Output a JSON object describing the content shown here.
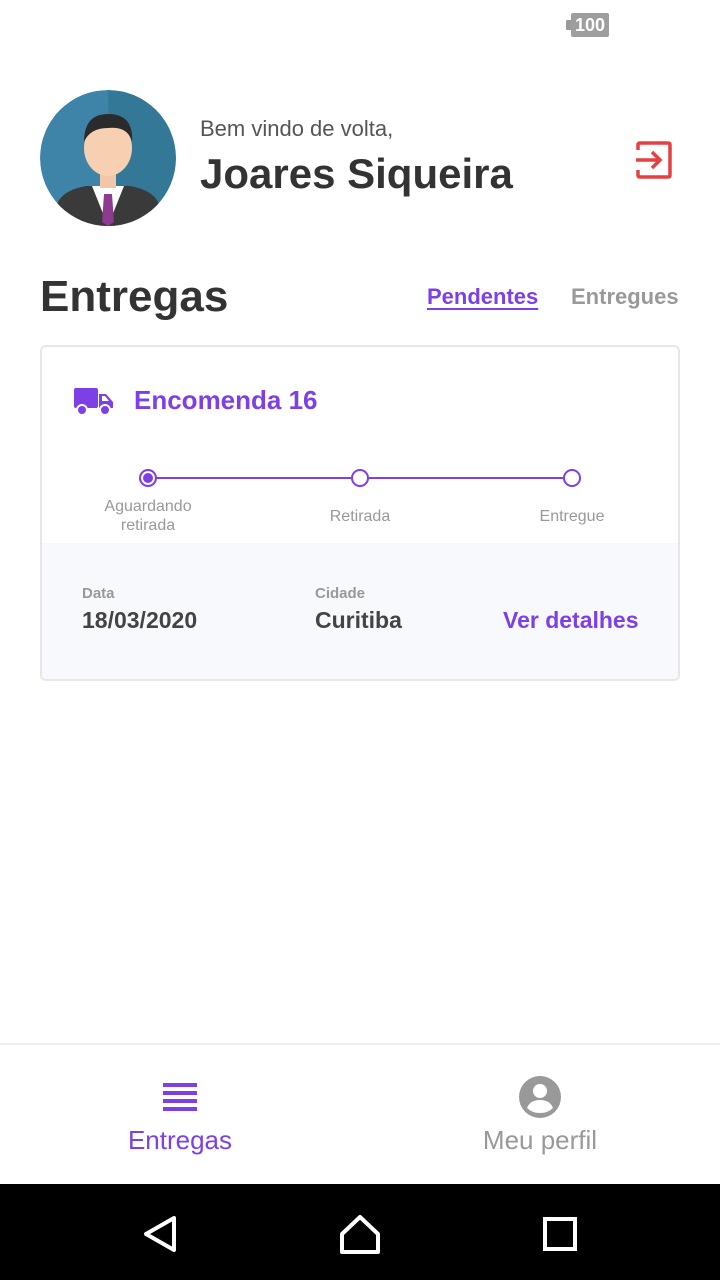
{
  "status_bar": {
    "battery_level": "100"
  },
  "header": {
    "greeting": "Bem vindo de volta,",
    "user_name": "Joares Siqueira"
  },
  "section": {
    "title": "Entregas",
    "tabs": [
      {
        "label": "Pendentes",
        "active": true
      },
      {
        "label": "Entregues",
        "active": false
      }
    ]
  },
  "delivery_card": {
    "title": "Encomenda 16",
    "progress_steps": [
      "Aguardando\nretirada",
      "Retirada",
      "Entregue"
    ],
    "current_step": 0,
    "date_label": "Data",
    "date_value": "18/03/2020",
    "city_label": "Cidade",
    "city_value": "Curitiba",
    "details_link": "Ver detalhes"
  },
  "bottom_tabs": [
    {
      "label": "Entregas",
      "icon": "list-icon",
      "active": true
    },
    {
      "label": "Meu perfil",
      "icon": "account-circle-icon",
      "active": false
    }
  ],
  "colors": {
    "accent": "#7d40e7",
    "logout_red": "#e74040",
    "inactive_gray": "#999999"
  }
}
